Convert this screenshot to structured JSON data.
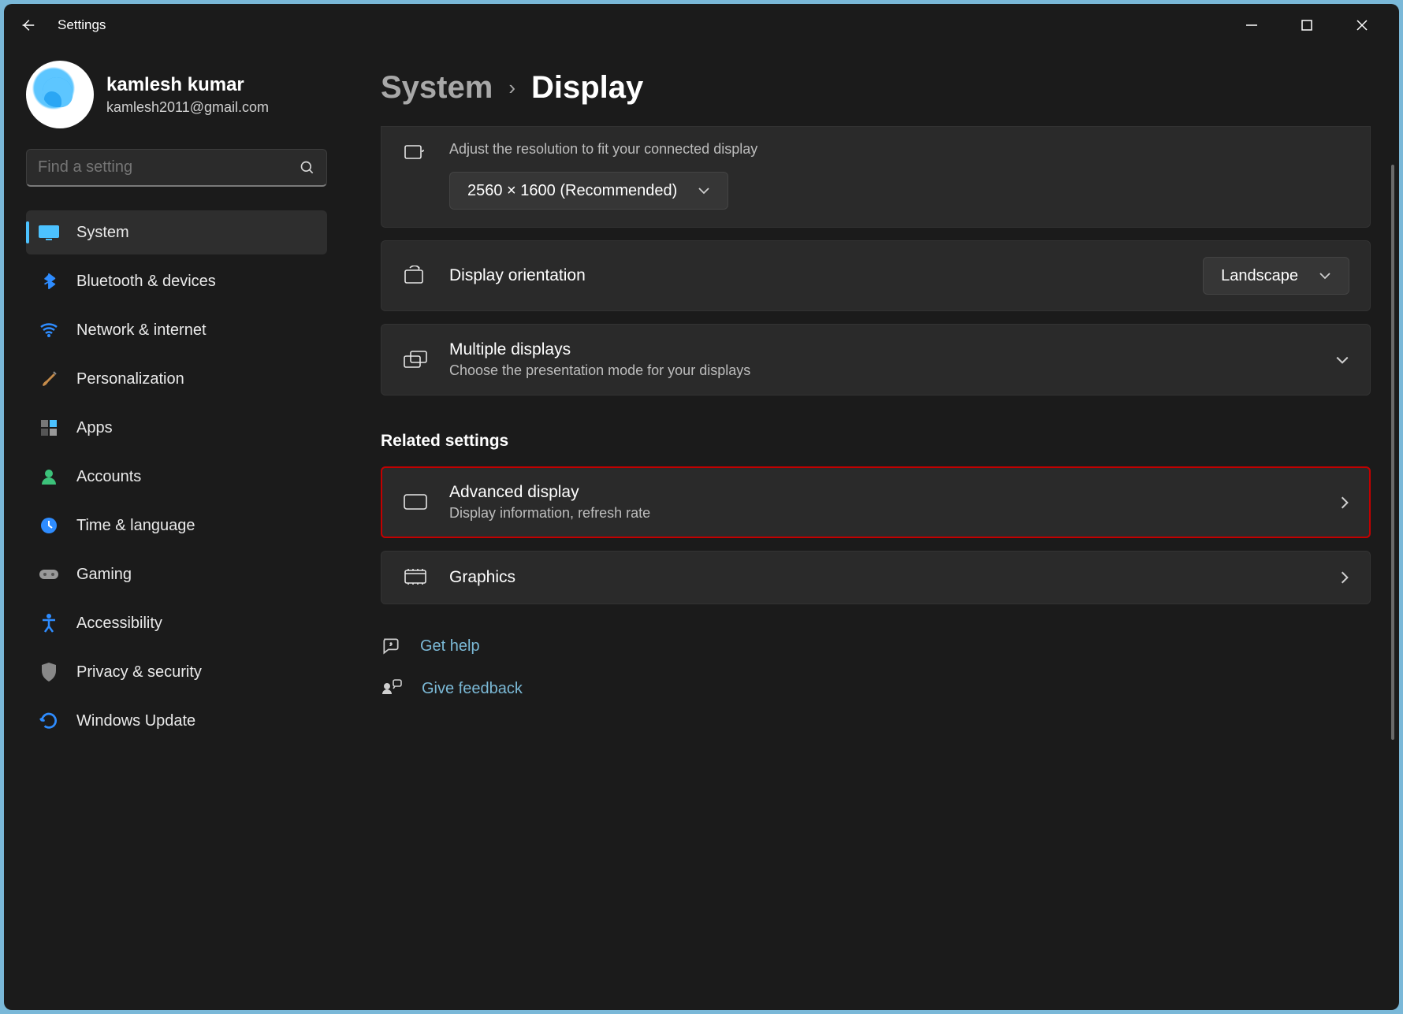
{
  "app_title": "Settings",
  "user": {
    "name": "kamlesh kumar",
    "email": "kamlesh2011@gmail.com"
  },
  "search_placeholder": "Find a setting",
  "sidebar": {
    "items": [
      {
        "label": "System",
        "icon": "monitor",
        "active": true
      },
      {
        "label": "Bluetooth & devices",
        "icon": "bluetooth"
      },
      {
        "label": "Network & internet",
        "icon": "wifi"
      },
      {
        "label": "Personalization",
        "icon": "brush"
      },
      {
        "label": "Apps",
        "icon": "apps"
      },
      {
        "label": "Accounts",
        "icon": "person"
      },
      {
        "label": "Time & language",
        "icon": "clock"
      },
      {
        "label": "Gaming",
        "icon": "gamepad"
      },
      {
        "label": "Accessibility",
        "icon": "accessibility"
      },
      {
        "label": "Privacy & security",
        "icon": "shield"
      },
      {
        "label": "Windows Update",
        "icon": "update"
      }
    ]
  },
  "breadcrumbs": {
    "parent": "System",
    "current": "Display"
  },
  "panels": {
    "resolution": {
      "subtitle": "Adjust the resolution to fit your connected display",
      "value": "2560 × 1600 (Recommended)"
    },
    "orientation": {
      "title": "Display orientation",
      "value": "Landscape"
    },
    "multiple": {
      "title": "Multiple displays",
      "subtitle": "Choose the presentation mode for your displays"
    },
    "advanced": {
      "title": "Advanced display",
      "subtitle": "Display information, refresh rate"
    },
    "graphics": {
      "title": "Graphics"
    }
  },
  "section_related": "Related settings",
  "links": {
    "help": "Get help",
    "feedback": "Give feedback"
  }
}
